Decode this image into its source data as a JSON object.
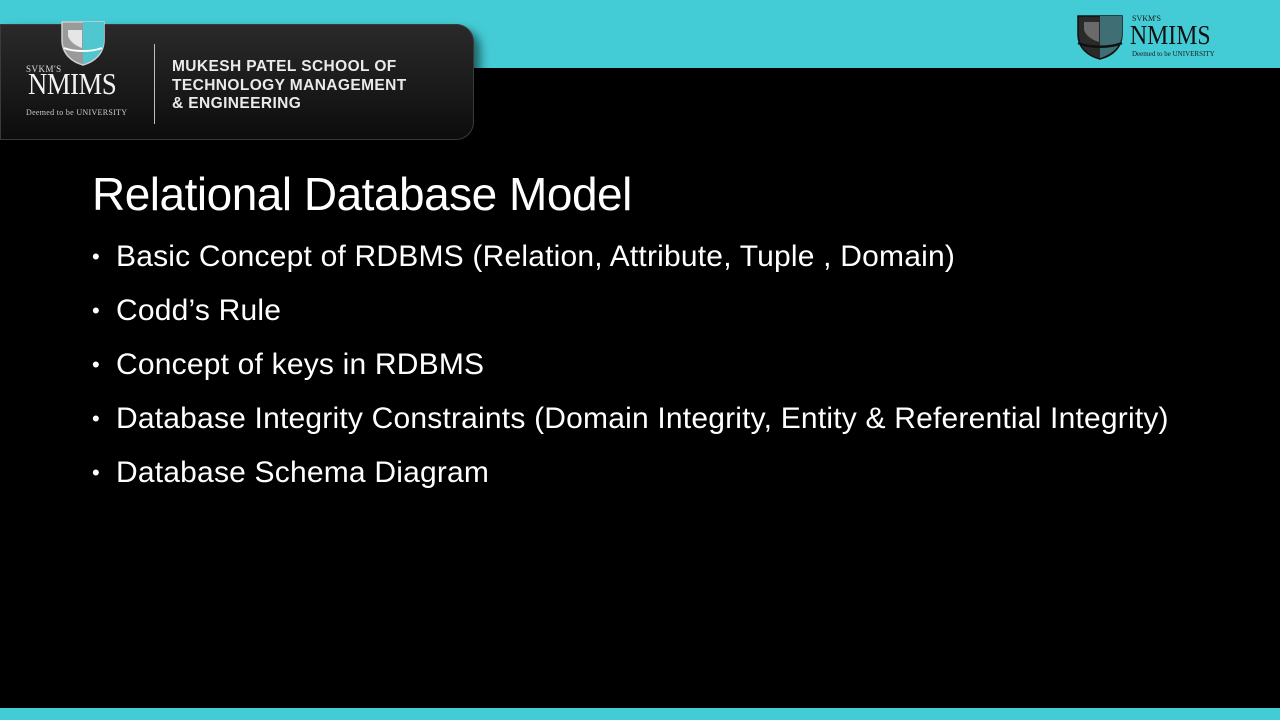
{
  "header": {
    "logo_left": {
      "svkms": "SVKM'S",
      "name": "NMIMS",
      "tagline": "Deemed to be UNIVERSITY"
    },
    "school_name_lines": [
      "MUKESH PATEL SCHOOL OF",
      "TECHNOLOGY MANAGEMENT",
      "& ENGINEERING"
    ],
    "logo_right": {
      "svkms": "SVKM'S",
      "name": "NMIMS",
      "tagline": "Deemed to be UNIVERSITY"
    }
  },
  "slide": {
    "title": "Relational Database Model",
    "bullet_marker": "•",
    "bullets": [
      "Basic Concept of RDBMS (Relation, Attribute, Tuple , Domain)",
      "Codd’s Rule",
      "Concept of keys in RDBMS",
      "Database Integrity Constraints (Domain Integrity, Entity & Referential Integrity)",
      "Database Schema Diagram"
    ]
  },
  "colors": {
    "accent_teal": "#44ccd6",
    "background": "#000000",
    "text": "#ffffff"
  },
  "icons": [
    "nmims-crest-icon"
  ]
}
